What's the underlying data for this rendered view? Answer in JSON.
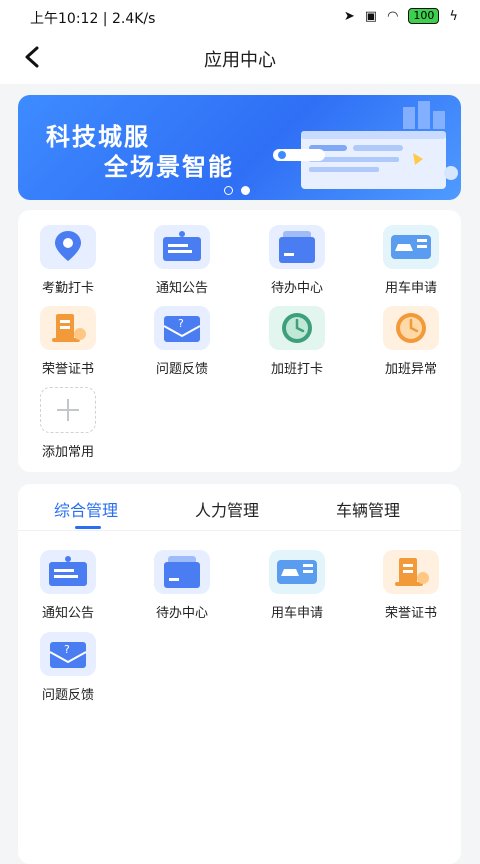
{
  "status": {
    "time": "上午10:12 | 2.4K/s",
    "battery": "100"
  },
  "nav": {
    "title": "应用中心"
  },
  "banner": {
    "line1": "科技城服",
    "line2": "全场景智能"
  },
  "apps": [
    {
      "label": "考勤打卡",
      "icon": "location-pin-icon"
    },
    {
      "label": "通知公告",
      "icon": "notice-icon"
    },
    {
      "label": "待办中心",
      "icon": "todo-folder-icon"
    },
    {
      "label": "用车申请",
      "icon": "car-icon"
    },
    {
      "label": "荣誉证书",
      "icon": "certificate-icon"
    },
    {
      "label": "问题反馈",
      "icon": "question-mail-icon"
    },
    {
      "label": "加班打卡",
      "icon": "clock-green-icon"
    },
    {
      "label": "加班异常",
      "icon": "clock-orange-icon"
    },
    {
      "label": "添加常用",
      "icon": "add-icon"
    }
  ],
  "tabs": [
    "综合管理",
    "人力管理",
    "车辆管理"
  ],
  "tab_apps": [
    {
      "label": "通知公告",
      "icon": "notice-icon"
    },
    {
      "label": "待办中心",
      "icon": "todo-folder-icon"
    },
    {
      "label": "用车申请",
      "icon": "car-icon"
    },
    {
      "label": "荣誉证书",
      "icon": "certificate-icon"
    },
    {
      "label": "问题反馈",
      "icon": "question-mail-icon"
    }
  ],
  "colors": {
    "accent": "#2a6ff0",
    "blue_icon": "#4a7df2",
    "orange_icon": "#f29a3a",
    "green_icon": "#3ea07a"
  }
}
